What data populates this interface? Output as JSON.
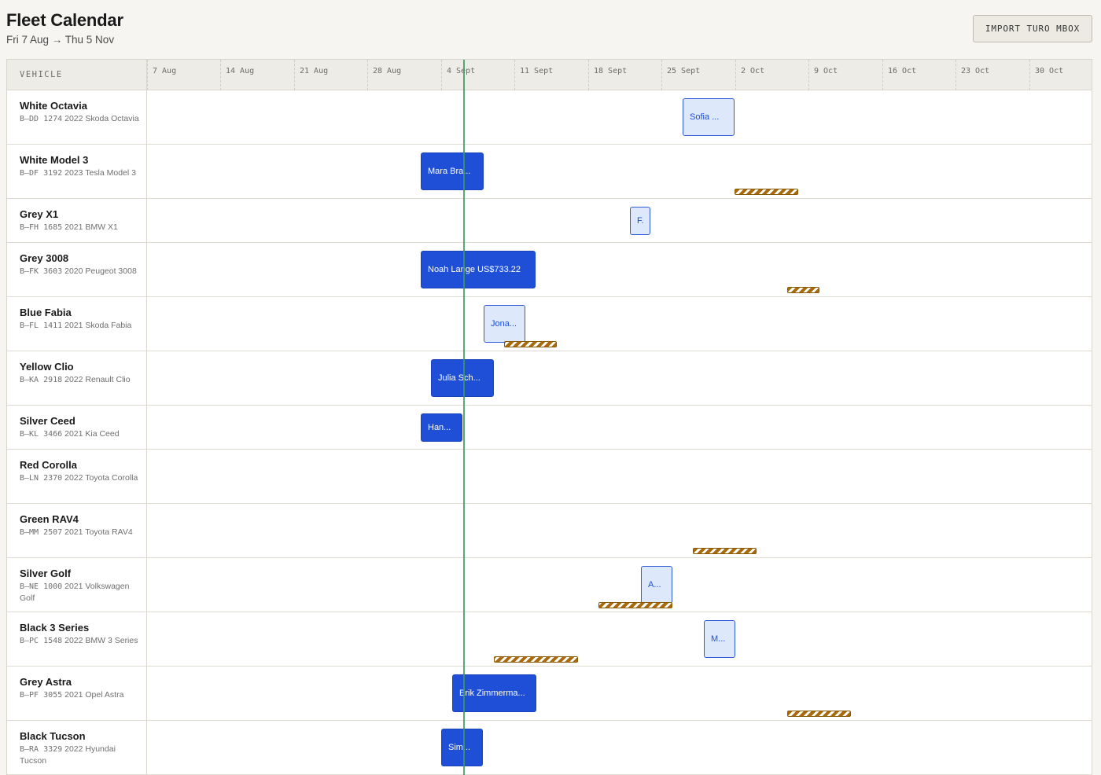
{
  "header": {
    "title": "Fleet Calendar",
    "date_range": "Fri 7 Aug → Thu 5 Nov",
    "import_button": "IMPORT TURO MBOX"
  },
  "calendar": {
    "vehicle_column_label": "VEHICLE",
    "weeks": [
      "7 Aug",
      "14 Aug",
      "21 Aug",
      "28 Aug",
      "4 Sept",
      "11 Sept",
      "18 Sept",
      "25 Sept",
      "2 Oct",
      "9 Oct",
      "16 Oct",
      "23 Oct",
      "30 Oct"
    ],
    "today_marker_color": "#3a9a5e",
    "booking_color": "#1f4fd6",
    "maintenance_color": "#a96a0c"
  },
  "vehicles": [
    {
      "name": "White Octavia",
      "plate": "B–DD 1274",
      "details": "2022 Skoda Octavia"
    },
    {
      "name": "White Model 3",
      "plate": "B–DF 3192",
      "details": "2023 Tesla Model 3"
    },
    {
      "name": "Grey X1",
      "plate": "B–FH 1685",
      "details": "2021 BMW X1"
    },
    {
      "name": "Grey 3008",
      "plate": "B–FK 3603",
      "details": "2020 Peugeot 3008"
    },
    {
      "name": "Blue Fabia",
      "plate": "B–FL 1411",
      "details": "2021 Skoda Fabia"
    },
    {
      "name": "Yellow Clio",
      "plate": "B–KA 2918",
      "details": "2022 Renault Clio"
    },
    {
      "name": "Silver Ceed",
      "plate": "B–KL 3466",
      "details": "2021 Kia Ceed"
    },
    {
      "name": "Red Corolla",
      "plate": "B–LN 2370",
      "details": "2022 Toyota Corolla"
    },
    {
      "name": "Green RAV4",
      "plate": "B–MM 2507",
      "details": "2021 Toyota RAV4"
    },
    {
      "name": "Silver Golf",
      "plate": "B–NE 1000",
      "details": "2021 Volkswagen Golf"
    },
    {
      "name": "Black 3 Series",
      "plate": "B–PC 1548",
      "details": "2022 BMW 3 Series"
    },
    {
      "name": "Grey Astra",
      "plate": "B–PF 3055",
      "details": "2021 Opel Astra"
    },
    {
      "name": "Black Tucson",
      "plate": "B–RA 3329",
      "details": "2022 Hyundai Tucson"
    }
  ],
  "bookings": [
    {
      "label": "Sofia ...",
      "style": "light"
    },
    {
      "label": "Mara Bra...",
      "style": "solid"
    },
    {
      "label": "F.",
      "style": "light"
    },
    {
      "label": "Noah Lange US$733.22",
      "style": "solid"
    },
    {
      "label": "Jona...",
      "style": "light"
    },
    {
      "label": "Julia Sch...",
      "style": "solid"
    },
    {
      "label": "Han...",
      "style": "solid"
    },
    {
      "label": "A...",
      "style": "light"
    },
    {
      "label": "M...",
      "style": "light"
    },
    {
      "label": "Erik Zimmerma...",
      "style": "solid"
    },
    {
      "label": "Sim...",
      "style": "solid"
    }
  ]
}
